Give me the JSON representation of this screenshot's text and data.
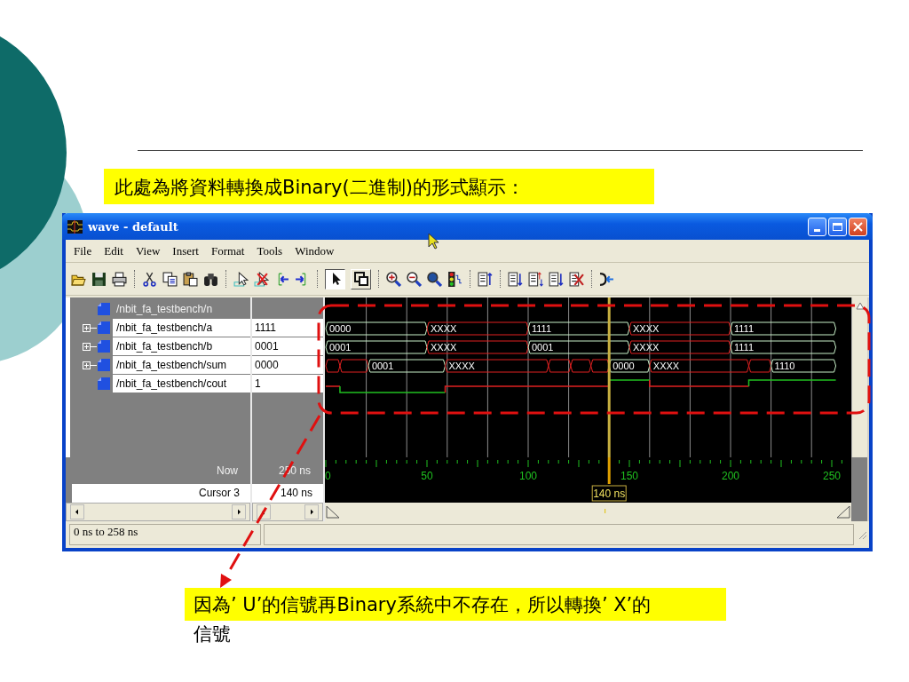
{
  "slide": {
    "heading": "此處為將資料轉換成Binary(二進制)的形式顯示：",
    "note": [
      "因為’ U’的信號再Binary系統中不存在，所以轉換’ X’的",
      "信號"
    ]
  },
  "window": {
    "title": "wave - default"
  },
  "menu": [
    "File",
    "Edit",
    "View",
    "Insert",
    "Format",
    "Tools",
    "Window"
  ],
  "toolbar": {
    "mouse_modes": [
      {
        "selected": true
      },
      {
        "selected": false
      }
    ]
  },
  "signals": [
    {
      "name": "/nbit_fa_testbench/n",
      "kind": "generic"
    },
    {
      "name": "/nbit_fa_testbench/a",
      "kind": "bus",
      "expanded": false,
      "value": "1111",
      "wave": [
        {
          "kind": "valid",
          "value": "0000"
        },
        {
          "kind": "unknown",
          "value": "XXXX"
        },
        {
          "kind": "valid",
          "value": "1111"
        },
        {
          "kind": "unknown",
          "value": "XXXX"
        },
        {
          "kind": "valid",
          "value": "1111"
        }
      ]
    },
    {
      "name": "/nbit_fa_testbench/b",
      "kind": "bus",
      "expanded": false,
      "value": "0001",
      "wave": [
        {
          "kind": "valid",
          "value": "0001"
        },
        {
          "kind": "unknown",
          "value": "XXXX"
        },
        {
          "kind": "valid",
          "value": "0001"
        },
        {
          "kind": "unknown",
          "value": "XXXX"
        },
        {
          "kind": "valid",
          "value": "1111"
        }
      ]
    },
    {
      "name": "/nbit_fa_testbench/sum",
      "kind": "bus",
      "expanded": false,
      "value": "0000",
      "wave": [
        {
          "kind": "unknown"
        },
        {
          "kind": "unknown"
        },
        {
          "kind": "valid",
          "value": "0001"
        },
        {
          "kind": "unknown",
          "value": "XXXX"
        },
        {
          "kind": "unknown"
        },
        {
          "kind": "unknown"
        },
        {
          "kind": "unknown"
        },
        {
          "kind": "valid",
          "value": "0000"
        },
        {
          "kind": "unknown",
          "value": "XXXX"
        },
        {
          "kind": "unknown"
        },
        {
          "kind": "valid",
          "value": "1110"
        }
      ]
    },
    {
      "name": "/nbit_fa_testbench/cout",
      "kind": "bit",
      "value": "1",
      "wave": [
        {
          "kind": "unknown"
        },
        {
          "kind": "low"
        },
        {
          "kind": "unknown"
        },
        {
          "kind": "high"
        },
        {
          "kind": "unknown"
        },
        {
          "kind": "high"
        }
      ]
    }
  ],
  "now": {
    "label": "Now",
    "time": "250 ns"
  },
  "cursor": {
    "name": "Cursor 3",
    "time": "140 ns",
    "flag": "140 ns"
  },
  "timeline": {
    "labels": [
      "0",
      "50",
      "100",
      "150",
      "200",
      "250"
    ]
  },
  "status_bar": {
    "range": "0 ns to 258 ns"
  }
}
